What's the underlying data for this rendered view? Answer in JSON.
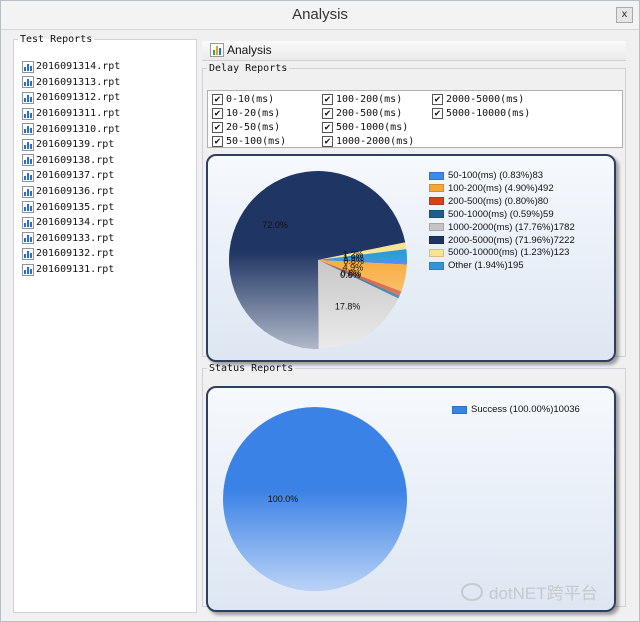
{
  "window": {
    "title": "Analysis",
    "close_label": "x"
  },
  "test_reports": {
    "title": "Test Reports",
    "files": [
      "2016091314.rpt",
      "2016091313.rpt",
      "2016091312.rpt",
      "2016091311.rpt",
      "2016091310.rpt",
      "201609139.rpt",
      "201609138.rpt",
      "201609137.rpt",
      "201609136.rpt",
      "201609135.rpt",
      "201609134.rpt",
      "201609133.rpt",
      "201609132.rpt",
      "201609131.rpt"
    ]
  },
  "tab": {
    "label": "Analysis"
  },
  "delay_reports": {
    "title": "Delay  Reports",
    "checkboxes": [
      {
        "label": "0-10(ms)",
        "checked": true
      },
      {
        "label": "10-20(ms)",
        "checked": true
      },
      {
        "label": "20-50(ms)",
        "checked": true
      },
      {
        "label": "50-100(ms)",
        "checked": true
      },
      {
        "label": "100-200(ms)",
        "checked": true
      },
      {
        "label": "200-500(ms)",
        "checked": true
      },
      {
        "label": "500-1000(ms)",
        "checked": true
      },
      {
        "label": "1000-2000(ms)",
        "checked": true
      },
      {
        "label": "2000-5000(ms)",
        "checked": true
      },
      {
        "label": "5000-10000(ms)",
        "checked": true
      }
    ]
  },
  "status_reports": {
    "title": "Status Reports"
  },
  "chart_data": [
    {
      "type": "pie",
      "slices": [
        {
          "label": "50-100(ms) (0.83%)83",
          "value": 83,
          "percent": 0.83,
          "color": "#3d8ae8",
          "slice_label": "0.8%"
        },
        {
          "label": "100-200(ms) (4.90%)492",
          "value": 492,
          "percent": 4.9,
          "color": "#f7a833",
          "slice_label": "4.9%"
        },
        {
          "label": "200-500(ms) (0.80%)80",
          "value": 80,
          "percent": 0.8,
          "color": "#d8421b",
          "slice_label": "0.8%"
        },
        {
          "label": "500-1000(ms) (0.59%)59",
          "value": 59,
          "percent": 0.59,
          "color": "#1c5f8c",
          "slice_label": "0.6%"
        },
        {
          "label": "1000-2000(ms) (17.76%)1782",
          "value": 1782,
          "percent": 17.76,
          "color": "#c4c4c4",
          "slice_label": "17.8%"
        },
        {
          "label": "2000-5000(ms) (71.96%)7222",
          "value": 7222,
          "percent": 71.96,
          "color": "#1f3563",
          "slice_label": "72.0%"
        },
        {
          "label": "5000-10000(ms) (1.23%)123",
          "value": 123,
          "percent": 1.23,
          "color": "#f7e493",
          "slice_label": "1.2%"
        },
        {
          "label": "Other (1.94%)195",
          "value": 195,
          "percent": 1.94,
          "color": "#2a9ad6",
          "slice_label": "1.9%"
        }
      ],
      "legend_position": "top-right"
    },
    {
      "type": "pie",
      "slices": [
        {
          "label": "Success (100.00%)10036",
          "value": 10036,
          "percent": 100.0,
          "color": "#3b82e6",
          "slice_label": "100.0%"
        }
      ],
      "legend_position": "top-right"
    }
  ],
  "watermark": {
    "text": "dotNET跨平台"
  }
}
